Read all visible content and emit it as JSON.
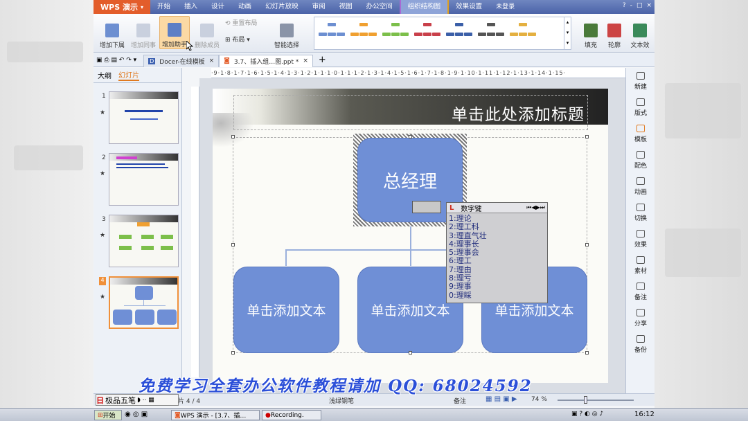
{
  "app": {
    "logo": "WPS 演示",
    "window_controls": [
      "?",
      "-",
      "□",
      "×"
    ],
    "unlogged": "未登录"
  },
  "tabs": [
    "开始",
    "插入",
    "设计",
    "动画",
    "幻灯片放映",
    "审阅",
    "视图",
    "办公空间",
    "组织结构图",
    "效果设置"
  ],
  "active_tab": "组织结构图",
  "ribbon": {
    "add_below": "增加下属",
    "add_peer": "增加同事",
    "add_assistant": "增加助手",
    "delete_member": "删除成员",
    "reset_layout": "重置布局",
    "layout": "布局",
    "smart_select": "智能选择",
    "fill": "填充",
    "outline": "轮廓",
    "text_effect": "文本效"
  },
  "doc_tabs": [
    {
      "label": "Docer-在线模板"
    },
    {
      "label": "3.7、插入组…图.ppt *"
    }
  ],
  "left_panel": {
    "tab_outline": "大纲",
    "tab_slides": "幻灯片",
    "slide_numbers": [
      "1",
      "2",
      "3",
      "4"
    ]
  },
  "ruler": {
    "text": "·9·1·8·1·7·1·6·1·5·1·4·1·3·1·2·1·1·1·0·1·1·1·2·1·3·1·4·1·5·1·6·1·7·1·8·1·9·1·10·1·11·1·12·1·13·1·14·1·15·"
  },
  "slide": {
    "title": "单击此处添加标题",
    "top_node": "总经理",
    "sub_nodes": [
      "单击添加文本",
      "单击添加文本",
      "单击添加文本"
    ]
  },
  "ime": {
    "title": "数字键",
    "candidates": [
      "1:理论",
      "2:理工科",
      "3:理直气壮",
      "4:理事长",
      "5:理事会",
      "6:理工",
      "7:理由",
      "8:理亏",
      "9:理事",
      "0:理睬"
    ]
  },
  "right_panel": [
    "新建",
    "版式",
    "模板",
    "配色",
    "动画",
    "切换",
    "效果",
    "素材",
    "备注",
    "分享",
    "备份"
  ],
  "status": {
    "slide_info": "片 4 / 4",
    "theme": "浅绿钢笔",
    "notes": "备注",
    "zoom": "74 %"
  },
  "ime_bar": {
    "label": "极品五笔"
  },
  "taskbar": {
    "start": "开始",
    "wps": "WPS 演示 - [3.7、插…",
    "recording": "Recording.",
    "clock": "16:12"
  },
  "watermark": "免费学习全套办公软件教程请加 QQ: 68024592",
  "colors": {
    "titlebar": "#4b63a8",
    "node": "#6f8fd6",
    "logo": "#e35d2b",
    "watermark": "#2b4fd8"
  }
}
